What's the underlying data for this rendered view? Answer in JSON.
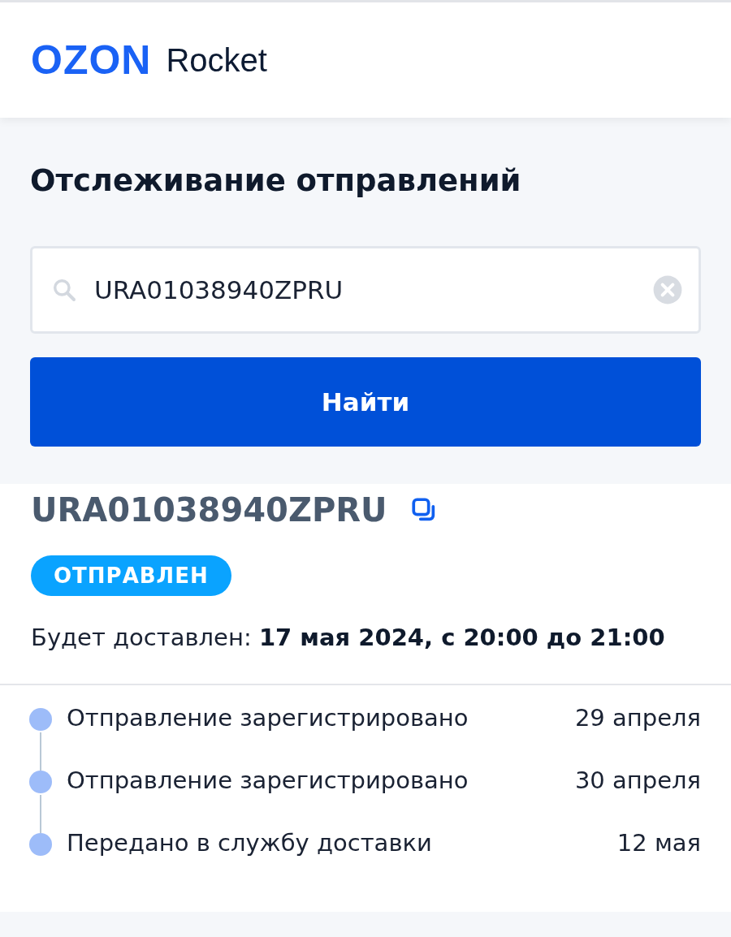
{
  "header": {
    "logo": {
      "brand": "OZON",
      "product": "Rocket"
    }
  },
  "tracking_form": {
    "title": "Отслеживание отправлений",
    "search": {
      "value": "URA01038940ZPRU"
    },
    "submit": "Найти"
  },
  "shipment": {
    "number": "URA01038940ZPRU",
    "status": "ОТПРАВЛЕН",
    "delivery": "Будет доставлен: **17 мая 2024, с 20:00 до 21:00**"
  },
  "events": [
    {
      "text": "Отправление зарегистрировано",
      "date": "29 апреля"
    },
    {
      "text": "Отправление зарегистрировано",
      "date": "30 апреля"
    },
    {
      "text": "Передано в службу доставки",
      "date": "12 мая"
    }
  ]
}
